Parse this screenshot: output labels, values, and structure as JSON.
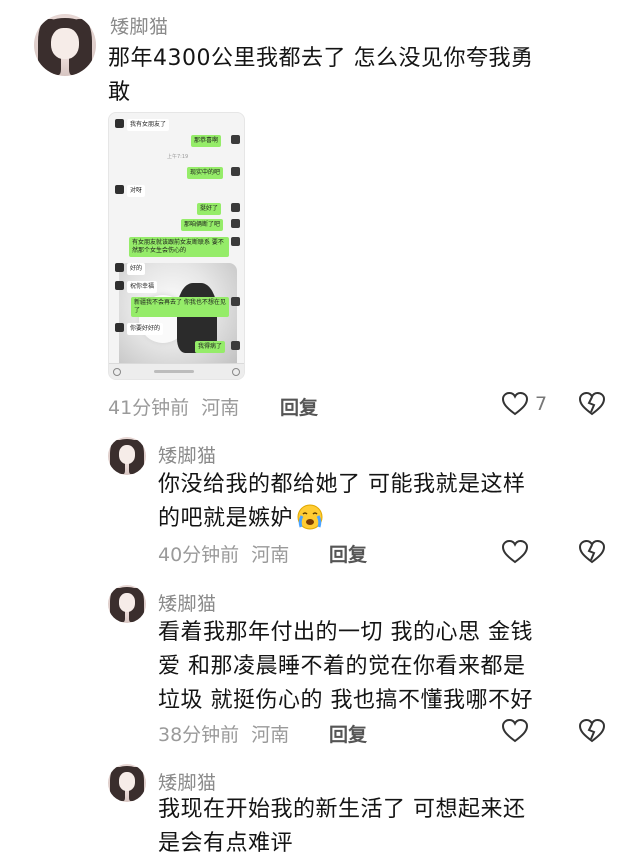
{
  "comments": [
    {
      "author": "矮脚猫",
      "text_line1": "那年4300公里我都去了 怎么没见你夸我勇",
      "text_line2": "敢",
      "time": "41分钟前",
      "location": "河南",
      "reply_label": "回复",
      "like_count": "7"
    },
    {
      "author": "矮脚猫",
      "text_line1": "你没给我的都给她了 可能我就是这样",
      "text_line2": "的吧就是嫉妒",
      "time": "40分钟前",
      "location": "河南",
      "reply_label": "回复"
    },
    {
      "author": "矮脚猫",
      "text_line1": "看着我那年付出的一切 我的心思 金钱",
      "text_line2": "爱 和那凌晨睡不着的觉在你看来都是",
      "text_line3": "垃圾 就挺伤心的 我也搞不懂我哪不好",
      "time": "38分钟前",
      "location": "河南",
      "reply_label": "回复"
    },
    {
      "author": "矮脚猫",
      "text_line1": "我现在开始我的新生活了 可想起来还",
      "text_line2": "是会有点难评"
    }
  ],
  "chat_image": {
    "messages": [
      {
        "side": "them",
        "text": "我有女朋友了"
      },
      {
        "side": "me",
        "text": "那恭喜啊"
      },
      {
        "time": "上午7:19"
      },
      {
        "side": "me",
        "text": "现实中的吧"
      },
      {
        "side": "them",
        "text": "对呀"
      },
      {
        "side": "me",
        "text": "挺好了"
      },
      {
        "side": "me",
        "text": "那咱俩断了吧"
      },
      {
        "side": "me",
        "text": "有女朋友就该跟前女友断联系 要不然那个女生会伤心的"
      },
      {
        "side": "them",
        "text": "好的"
      },
      {
        "side": "them",
        "text": "祝你幸福"
      },
      {
        "side": "me",
        "text": "新疆我不会再去了 你我也不想在见了"
      },
      {
        "side": "them",
        "text": "你要好好的"
      },
      {
        "side": "me",
        "text": "我得病了"
      }
    ]
  },
  "colors": {
    "wechat_green": "#95ec69",
    "name_gray": "#8a8a8a",
    "meta_gray": "#9a9a9a"
  },
  "icons": [
    "heart-icon",
    "broken-heart-icon",
    "crying-emoji-icon"
  ]
}
